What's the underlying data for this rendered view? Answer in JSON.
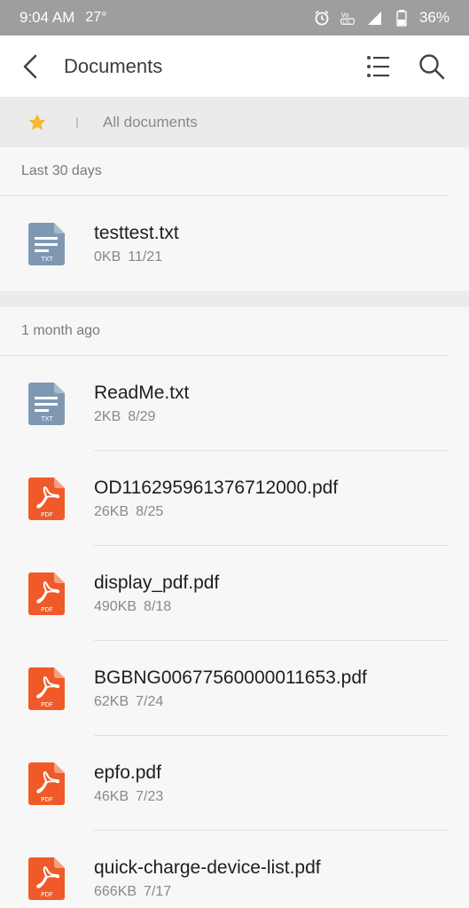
{
  "status_bar": {
    "time": "9:04 AM",
    "temperature": "27°",
    "battery": "36%",
    "icons": [
      "alarm-icon",
      "volte-icon",
      "signal-icon",
      "battery-icon"
    ]
  },
  "app_bar": {
    "title": "Documents",
    "icons": [
      "back-arrow-icon",
      "list-view-icon",
      "search-icon"
    ]
  },
  "breadcrumb": {
    "star_color": "#f5b82e",
    "label": "All documents"
  },
  "sections": [
    {
      "header": "Last 30 days",
      "files": [
        {
          "name": "testtest.txt",
          "size": "0KB",
          "date": "11/21",
          "type": "TXT"
        }
      ]
    },
    {
      "header": "1 month ago",
      "files": [
        {
          "name": "ReadMe.txt",
          "size": "2KB",
          "date": "8/29",
          "type": "TXT"
        },
        {
          "name": "OD116295961376712000.pdf",
          "size": "26KB",
          "date": "8/25",
          "type": "PDF"
        },
        {
          "name": "display_pdf.pdf",
          "size": "490KB",
          "date": "8/18",
          "type": "PDF"
        },
        {
          "name": "BGBNG00677560000011653.pdf",
          "size": "62KB",
          "date": "7/24",
          "type": "PDF"
        },
        {
          "name": "epfo.pdf",
          "size": "46KB",
          "date": "7/23",
          "type": "PDF"
        },
        {
          "name": "quick-charge-device-list.pdf",
          "size": "666KB",
          "date": "7/17",
          "type": "PDF"
        }
      ]
    }
  ],
  "colors": {
    "txt_icon": "#7f98b2",
    "pdf_icon": "#f05a28"
  }
}
